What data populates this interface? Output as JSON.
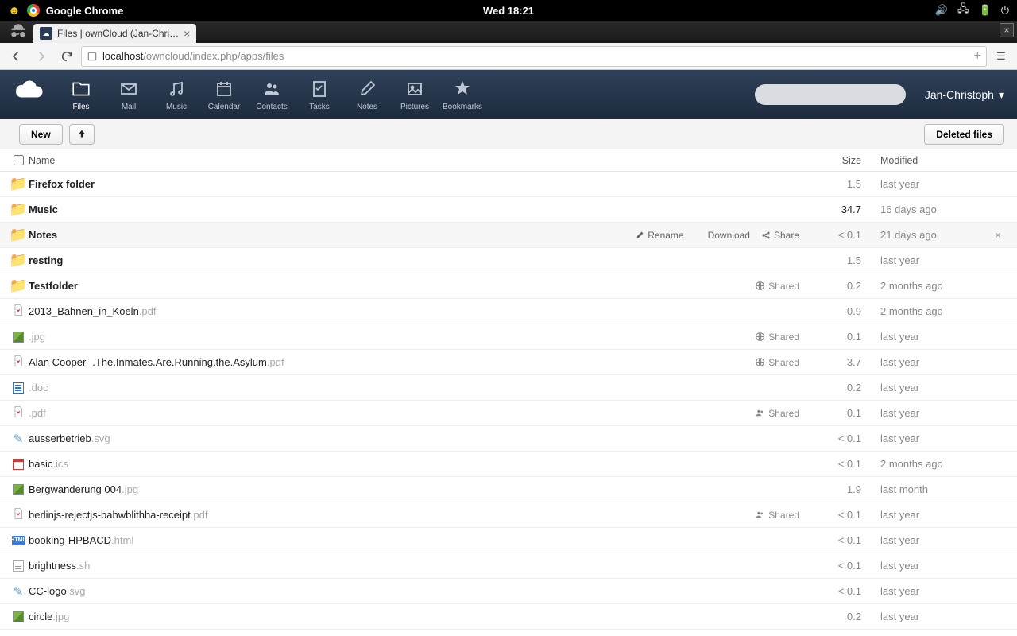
{
  "os": {
    "app_name": "Google Chrome",
    "clock": "Wed 18:21"
  },
  "browser": {
    "tab_title": "Files | ownCloud (Jan-Chri…",
    "url_host": "localhost",
    "url_path": "/owncloud/index.php/apps/files"
  },
  "header": {
    "apps": [
      {
        "id": "files",
        "label": "Files",
        "active": true
      },
      {
        "id": "mail",
        "label": "Mail"
      },
      {
        "id": "music",
        "label": "Music"
      },
      {
        "id": "calendar",
        "label": "Calendar"
      },
      {
        "id": "contacts",
        "label": "Contacts"
      },
      {
        "id": "tasks",
        "label": "Tasks"
      },
      {
        "id": "notes",
        "label": "Notes"
      },
      {
        "id": "pictures",
        "label": "Pictures"
      },
      {
        "id": "bookmarks",
        "label": "Bookmarks"
      }
    ],
    "search_placeholder": "",
    "user": "Jan-Christoph"
  },
  "controls": {
    "new_label": "New",
    "deleted_label": "Deleted files"
  },
  "columns": {
    "name": "Name",
    "size": "Size",
    "modified": "Modified"
  },
  "row_actions": {
    "rename": "Rename",
    "download": "Download",
    "share": "Share"
  },
  "shared_label": "Shared",
  "files": [
    {
      "name": "Firefox folder",
      "ext": "",
      "type": "folder",
      "size": "1.5",
      "mod": "last year"
    },
    {
      "name": "Music",
      "ext": "",
      "type": "folder",
      "size": "34.7",
      "size_dark": true,
      "mod": "16 days ago"
    },
    {
      "name": "Notes",
      "ext": "",
      "type": "folder",
      "size": "< 0.1",
      "mod": "21 days ago",
      "hover": true
    },
    {
      "name": "resting",
      "ext": "",
      "type": "folder",
      "size": "1.5",
      "mod": "last year"
    },
    {
      "name": "Testfolder",
      "ext": "",
      "type": "folder",
      "size": "0.2",
      "mod": "2 months ago",
      "shared": "public"
    },
    {
      "name": "2013_Bahnen_in_Koeln",
      "ext": ".pdf",
      "type": "pdf",
      "size": "0.9",
      "mod": "2 months ago"
    },
    {
      "name": "",
      "ext": ".jpg",
      "type": "img",
      "size": "0.1",
      "mod": "last year",
      "shared": "public"
    },
    {
      "name": "Alan Cooper -.The.Inmates.Are.Running.the.Asylum",
      "ext": ".pdf",
      "type": "pdf",
      "size": "3.7",
      "mod": "last year",
      "shared": "public"
    },
    {
      "name": "",
      "ext": ".doc",
      "type": "doc",
      "size": "0.2",
      "mod": "last year"
    },
    {
      "name": "",
      "ext": ".pdf",
      "type": "pdf",
      "size": "0.1",
      "mod": "last year",
      "shared": "users"
    },
    {
      "name": "ausserbetrieb",
      "ext": ".svg",
      "type": "svg",
      "size": "< 0.1",
      "mod": "last year"
    },
    {
      "name": "basic",
      "ext": ".ics",
      "type": "ics",
      "size": "< 0.1",
      "mod": "2 months ago"
    },
    {
      "name": "Bergwanderung 004",
      "ext": ".jpg",
      "type": "img",
      "size": "1.9",
      "mod": "last month"
    },
    {
      "name": "berlinjs-rejectjs-bahwblithha-receipt",
      "ext": ".pdf",
      "type": "pdf",
      "size": "< 0.1",
      "mod": "last year",
      "shared": "users"
    },
    {
      "name": "booking-HPBACD",
      "ext": ".html",
      "type": "html",
      "size": "< 0.1",
      "mod": "last year"
    },
    {
      "name": "brightness",
      "ext": ".sh",
      "type": "txt",
      "size": "< 0.1",
      "mod": "last year"
    },
    {
      "name": "CC-logo",
      "ext": ".svg",
      "type": "svg",
      "size": "< 0.1",
      "mod": "last year"
    },
    {
      "name": "circle",
      "ext": ".jpg",
      "type": "img",
      "size": "0.2",
      "mod": "last year"
    }
  ]
}
